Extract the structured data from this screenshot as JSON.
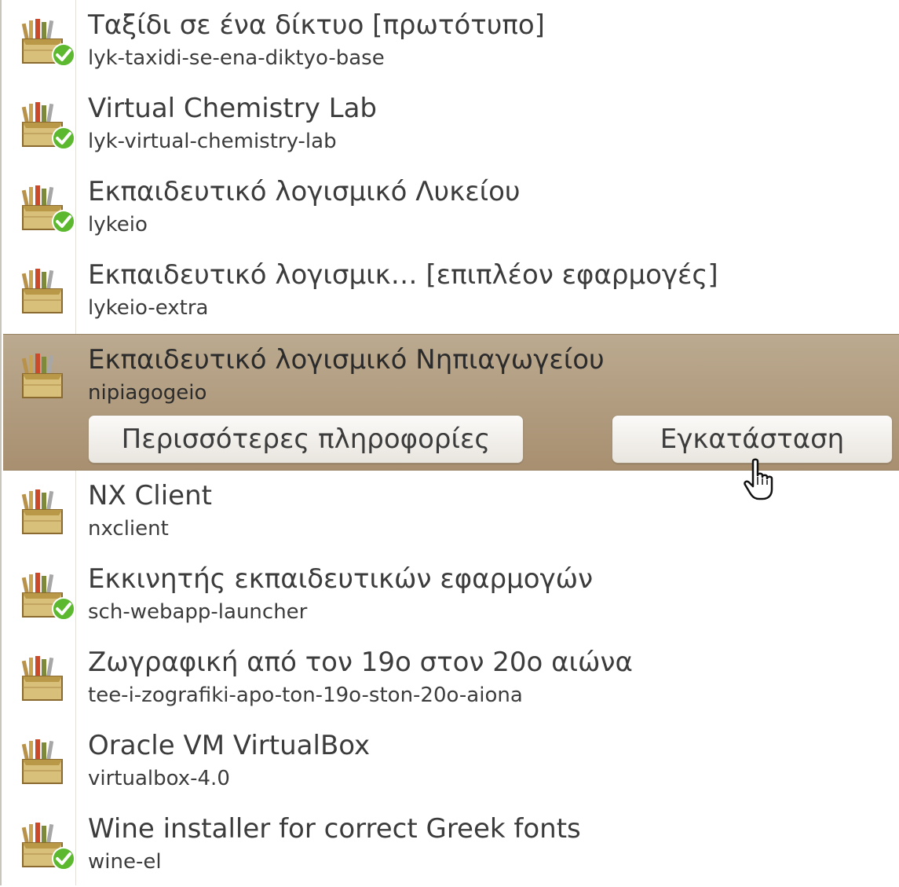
{
  "packages": [
    {
      "title": "Ταξίδι σε ένα δίκτυο [πρωτότυπο]",
      "name": "lyk-taxidi-se-ena-diktyo-base",
      "installed": true
    },
    {
      "title": "Virtual Chemistry Lab",
      "name": "lyk-virtual-chemistry-lab",
      "installed": true
    },
    {
      "title": "Εκπαιδευτικό λογισμικό Λυκείου",
      "name": "lykeio",
      "installed": true
    },
    {
      "title": "Εκπαιδευτικό λογισμικ… [επιπλέον εφαρμογές]",
      "name": "lykeio-extra",
      "installed": false
    },
    {
      "title": "Εκπαιδευτικό λογισμικό Νηπιαγωγείου",
      "name": "nipiagogeio",
      "installed": false,
      "selected": true
    },
    {
      "title": "NX Client",
      "name": "nxclient",
      "installed": false
    },
    {
      "title": "Εκκινητής εκπαιδευτικών εφαρμογών",
      "name": "sch-webapp-launcher",
      "installed": true
    },
    {
      "title": "Ζωγραφική από τον 19ο στον 20ο αιώνα",
      "name": "tee-i-zografiki-apo-ton-19o-ston-20o-aiona",
      "installed": false
    },
    {
      "title": "Oracle VM VirtualBox",
      "name": "virtualbox-4.0",
      "installed": false
    },
    {
      "title": "Wine installer for correct Greek fonts",
      "name": "wine-el",
      "installed": true
    }
  ],
  "actions": {
    "more_info_label": "Περισσότερες πληροφορίες",
    "install_label": "Εγκατάσταση"
  },
  "icons": {
    "package": "package-icon",
    "installed_badge": "installed-check-icon",
    "cursor": "hand-pointer-icon"
  },
  "colors": {
    "selected_row": "#b29c7f",
    "installed_badge": "#5cb82e",
    "text": "#3c3c3c"
  }
}
